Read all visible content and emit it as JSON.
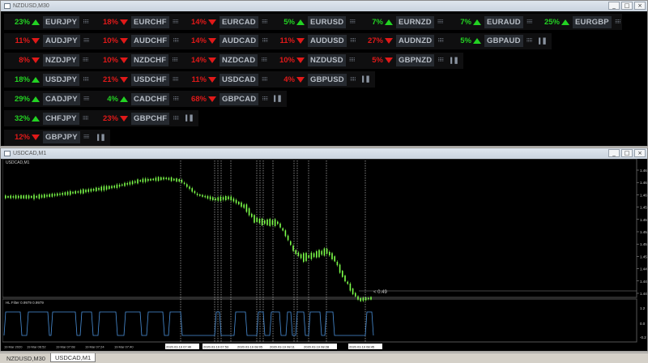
{
  "top_window": {
    "title": "NZDUSD,M30",
    "buttons": [
      "_",
      "□",
      "×"
    ],
    "rows": [
      [
        {
          "pct": "23%",
          "dir": "up",
          "pair": "EURJPY"
        },
        {
          "pct": "18%",
          "dir": "down",
          "pair": "EURCHF"
        },
        {
          "pct": "14%",
          "dir": "down",
          "pair": "EURCAD"
        },
        {
          "pct": "5%",
          "dir": "up",
          "pair": "EURUSD"
        },
        {
          "pct": "7%",
          "dir": "up",
          "pair": "EURNZD"
        },
        {
          "pct": "7%",
          "dir": "up",
          "pair": "EURAUD"
        },
        {
          "pct": "25%",
          "dir": "up",
          "pair": "EURGBP"
        }
      ],
      [
        {
          "pct": "11%",
          "dir": "down",
          "pair": "AUDJPY"
        },
        {
          "pct": "10%",
          "dir": "down",
          "pair": "AUDCHF"
        },
        {
          "pct": "14%",
          "dir": "down",
          "pair": "AUDCAD"
        },
        {
          "pct": "11%",
          "dir": "down",
          "pair": "AUDUSD"
        },
        {
          "pct": "27%",
          "dir": "down",
          "pair": "AUDNZD"
        },
        {
          "pct": "5%",
          "dir": "up",
          "pair": "GBPAUD"
        }
      ],
      [
        {
          "pct": "8%",
          "dir": "down",
          "pair": "NZDJPY"
        },
        {
          "pct": "10%",
          "dir": "down",
          "pair": "NZDCHF"
        },
        {
          "pct": "14%",
          "dir": "down",
          "pair": "NZDCAD"
        },
        {
          "pct": "10%",
          "dir": "down",
          "pair": "NZDUSD"
        },
        {
          "pct": "5%",
          "dir": "down",
          "pair": "GBPNZD"
        }
      ],
      [
        {
          "pct": "18%",
          "dir": "up",
          "pair": "USDJPY"
        },
        {
          "pct": "21%",
          "dir": "down",
          "pair": "USDCHF"
        },
        {
          "pct": "11%",
          "dir": "down",
          "pair": "USDCAD"
        },
        {
          "pct": "4%",
          "dir": "down",
          "pair": "GBPUSD"
        }
      ],
      [
        {
          "pct": "29%",
          "dir": "up",
          "pair": "CADJPY"
        },
        {
          "pct": "4%",
          "dir": "up",
          "pair": "CADCHF"
        },
        {
          "pct": "68%",
          "dir": "down",
          "pair": "GBPCAD"
        }
      ],
      [
        {
          "pct": "32%",
          "dir": "up",
          "pair": "CHFJPY"
        },
        {
          "pct": "23%",
          "dir": "down",
          "pair": "GBPCHF"
        }
      ],
      [
        {
          "pct": "12%",
          "dir": "down",
          "pair": "GBPJPY"
        }
      ]
    ]
  },
  "chart_window": {
    "title": "USDCAD,M1",
    "buttons": [
      "_",
      "□",
      "×"
    ],
    "symbol_label": "USDCAD,M1",
    "price_labels": [
      "1.463",
      "1.462",
      "1.460",
      "1.458",
      "1.456",
      "1.454",
      "1.453",
      "1.451",
      "1.449",
      "1.447",
      "1.446"
    ],
    "countdown": "< 0:49",
    "indicator_label": "HL Filter 0.9979 0.9979",
    "indicator_scale": [
      "1.2",
      "0.0",
      "-0.2"
    ],
    "time_labels": [
      "19 Mar 2020",
      "19 Mar 06:52",
      "19 Mar 07:08",
      "19 Mar 07:24",
      "19 Mar 07:40",
      "2020.03.19 07:40",
      "2020.03.19 07:53",
      "2020.03.19 08:05",
      "2020.03.19 08:11",
      "2020.03.19 08:28",
      "2020.03.19 08:45"
    ],
    "colors": {
      "candle": "#7cff4a",
      "indicator": "#4a90d9",
      "grid": "#ffffff"
    }
  },
  "tabs": [
    {
      "label": "NZDUSD,M30",
      "active": false
    },
    {
      "label": "USDCAD,M1",
      "active": true
    }
  ]
}
